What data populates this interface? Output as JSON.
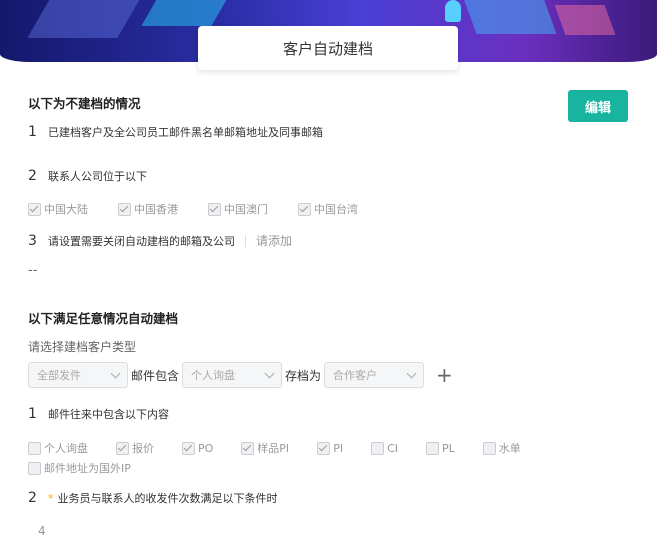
{
  "title": "客户自动建档",
  "edit_button": "编辑",
  "section1": {
    "title": "以下为不建档的情况",
    "item1": {
      "num": "1",
      "text": "已建档客户及全公司员工邮件黑名单邮箱地址及同事邮箱"
    },
    "item2": {
      "num": "2",
      "text": "联系人公司位于以下"
    },
    "regions": [
      {
        "label": "中国大陆",
        "checked": true
      },
      {
        "label": "中国香港",
        "checked": true
      },
      {
        "label": "中国澳门",
        "checked": true
      },
      {
        "label": "中国台湾",
        "checked": true
      }
    ],
    "item3": {
      "num": "3",
      "text": "请设置需要关闭自动建档的邮箱及公司",
      "link": "请添加"
    },
    "empty_value": "--"
  },
  "section2": {
    "title": "以下满足任意情况自动建档",
    "select_label": "请选择建档客户类型",
    "rule": {
      "select1": "全部发件",
      "mid_label": "邮件包含",
      "select2": "个人询盘",
      "save_label": "存档为",
      "select3": "合作客户"
    },
    "item1": {
      "num": "1",
      "text": "邮件往来中包含以下内容"
    },
    "contents": [
      {
        "label": "个人询盘",
        "checked": false
      },
      {
        "label": "报价",
        "checked": true
      },
      {
        "label": "PO",
        "checked": true
      },
      {
        "label": "样品PI",
        "checked": true
      },
      {
        "label": "PI",
        "checked": true
      },
      {
        "label": "CI",
        "checked": false
      },
      {
        "label": "PL",
        "checked": false
      },
      {
        "label": "水单",
        "checked": false
      }
    ],
    "foreign_label": "邮件地址为国外IP",
    "item2": {
      "num": "2",
      "star": "*",
      "text": "业务员与联系人的收发件次数满足以下条件时"
    },
    "count_value": "4"
  }
}
